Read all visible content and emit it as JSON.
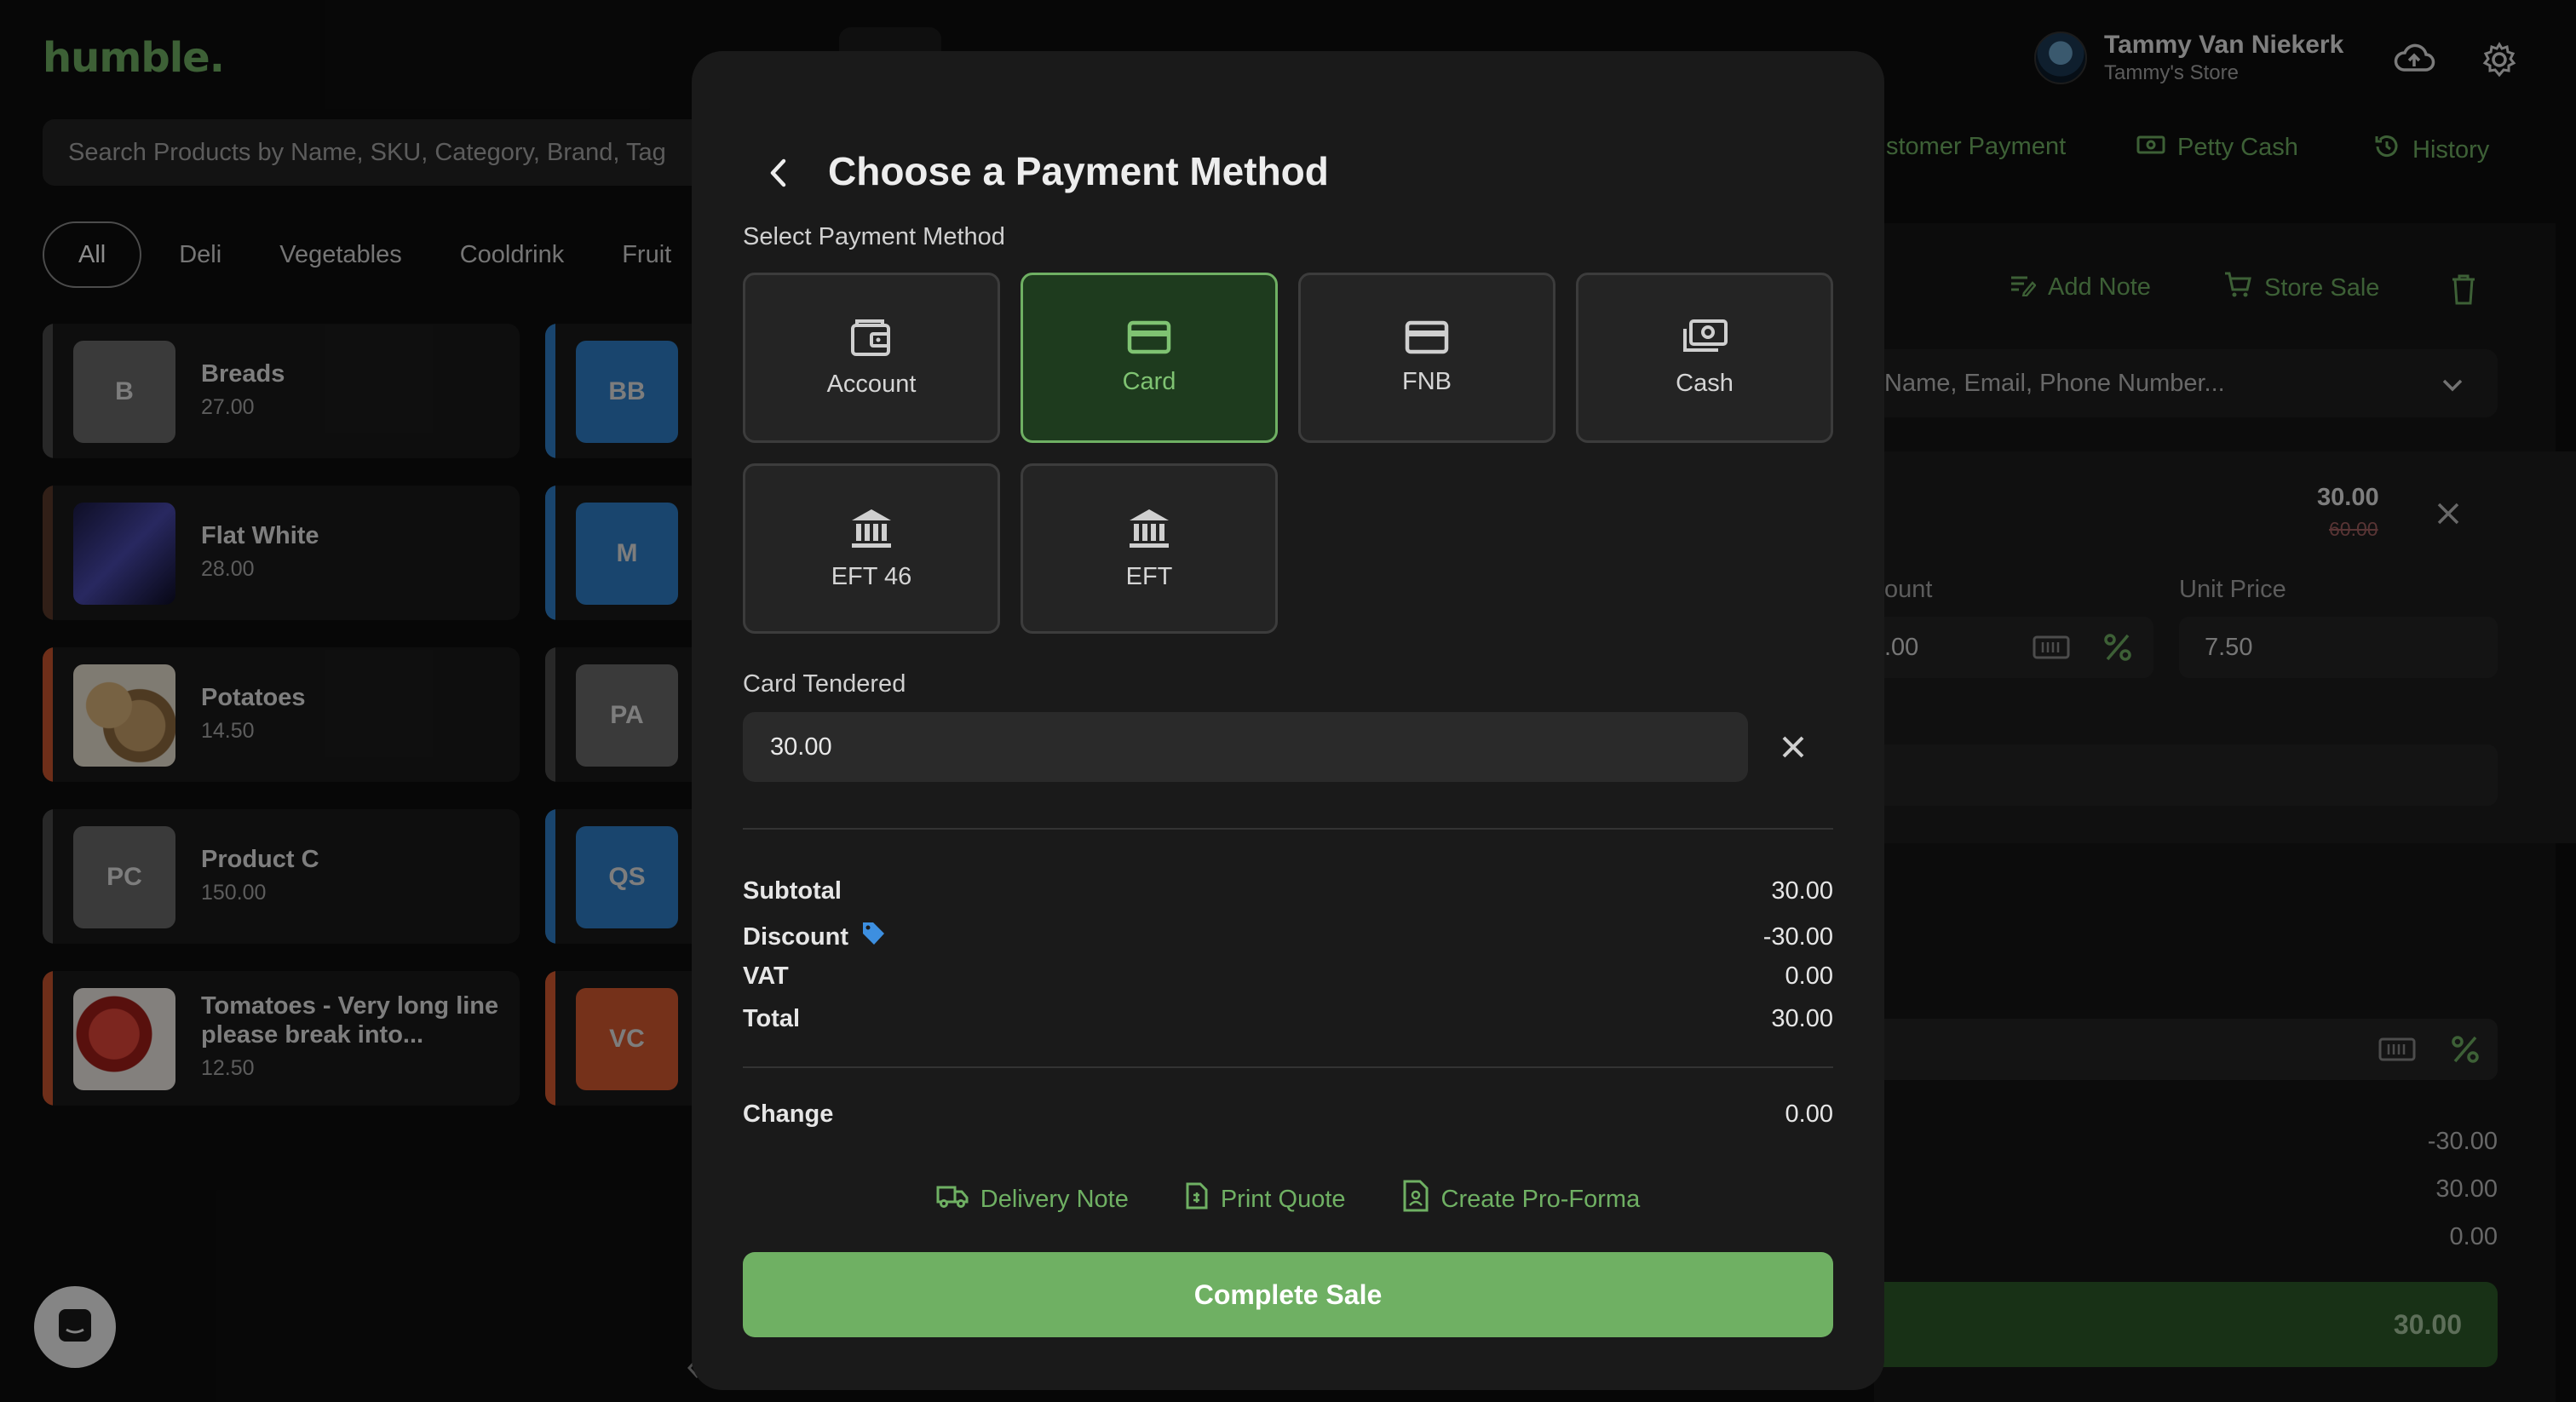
{
  "app": {
    "logo": "humble.",
    "search_placeholder": "Search Products by Name, SKU, Category, Brand, Tag",
    "categories": [
      "All",
      "Deli",
      "Vegetables",
      "Cooldrink",
      "Fruit"
    ],
    "products": [
      {
        "initials": "B",
        "name": "Breads",
        "price": "27.00",
        "stripe": "#4a4a4a",
        "thumb": "#6b6b6b"
      },
      {
        "initials": "",
        "name": "Flat White",
        "price": "28.00",
        "stripe": "#5a3a2a",
        "thumb": "#2b2b6b"
      },
      {
        "initials": "",
        "name": "Potatoes",
        "price": "14.50",
        "stripe": "#c8552e",
        "thumb": "#b8925a"
      },
      {
        "initials": "PC",
        "name": "Product C",
        "price": "150.00",
        "stripe": "#4a4a4a",
        "thumb": "#6b6b6b"
      },
      {
        "initials": "",
        "name": "Tomatoes - Very long line please break into...",
        "price": "12.50",
        "stripe": "#c8552e",
        "thumb": "#c0302a"
      }
    ],
    "second_col": [
      {
        "initials": "BB",
        "color": "#2f7fc8"
      },
      {
        "initials": "M",
        "color": "#2f7fc8"
      },
      {
        "initials": "PA",
        "color": "#6b6b6b"
      },
      {
        "initials": "QS",
        "color": "#2f7fc8"
      },
      {
        "initials": "VC",
        "color": "#d55a30"
      }
    ],
    "user": {
      "name": "Tammy Van Niekerk",
      "store": "Tammy's Store"
    },
    "quick_links": {
      "customer_payment": "stomer Payment",
      "petty_cash": "Petty Cash",
      "history": "History"
    },
    "cart": {
      "add_note": "Add Note",
      "store_sale": "Store Sale",
      "customer_placeholder": "Name, Email, Phone Number...",
      "item_price": "30.00",
      "item_original": "60.00",
      "discount_label": "ount",
      "discount_value": ".00",
      "unit_price_label": "Unit Price",
      "unit_price_value": "7.50",
      "summary": [
        "-30.00",
        "30.00",
        "0.00"
      ],
      "total_button": "30.00"
    }
  },
  "modal": {
    "title": "Choose a Payment Method",
    "select_label": "Select Payment Method",
    "methods": [
      {
        "label": "Account",
        "icon": "wallet-icon",
        "selected": false
      },
      {
        "label": "Card",
        "icon": "card-icon",
        "selected": true
      },
      {
        "label": "FNB",
        "icon": "card-icon",
        "selected": false
      },
      {
        "label": "Cash",
        "icon": "cash-icon",
        "selected": false
      },
      {
        "label": "EFT 46",
        "icon": "bank-icon",
        "selected": false
      },
      {
        "label": "EFT",
        "icon": "bank-icon",
        "selected": false
      }
    ],
    "tender_label": "Card Tendered",
    "tender_value": "30.00",
    "summary": {
      "subtotal_label": "Subtotal",
      "subtotal": "30.00",
      "discount_label": "Discount",
      "discount": "-30.00",
      "vat_label": "VAT",
      "vat": "0.00",
      "total_label": "Total",
      "total": "30.00",
      "change_label": "Change",
      "change": "0.00"
    },
    "links": {
      "delivery_note": "Delivery Note",
      "print_quote": "Print Quote",
      "pro_forma": "Create Pro-Forma"
    },
    "complete_label": "Complete Sale"
  },
  "colors": {
    "accent": "#6fb063",
    "modal_bg": "#1a1a1a",
    "page_bg": "#0e0e0e"
  }
}
